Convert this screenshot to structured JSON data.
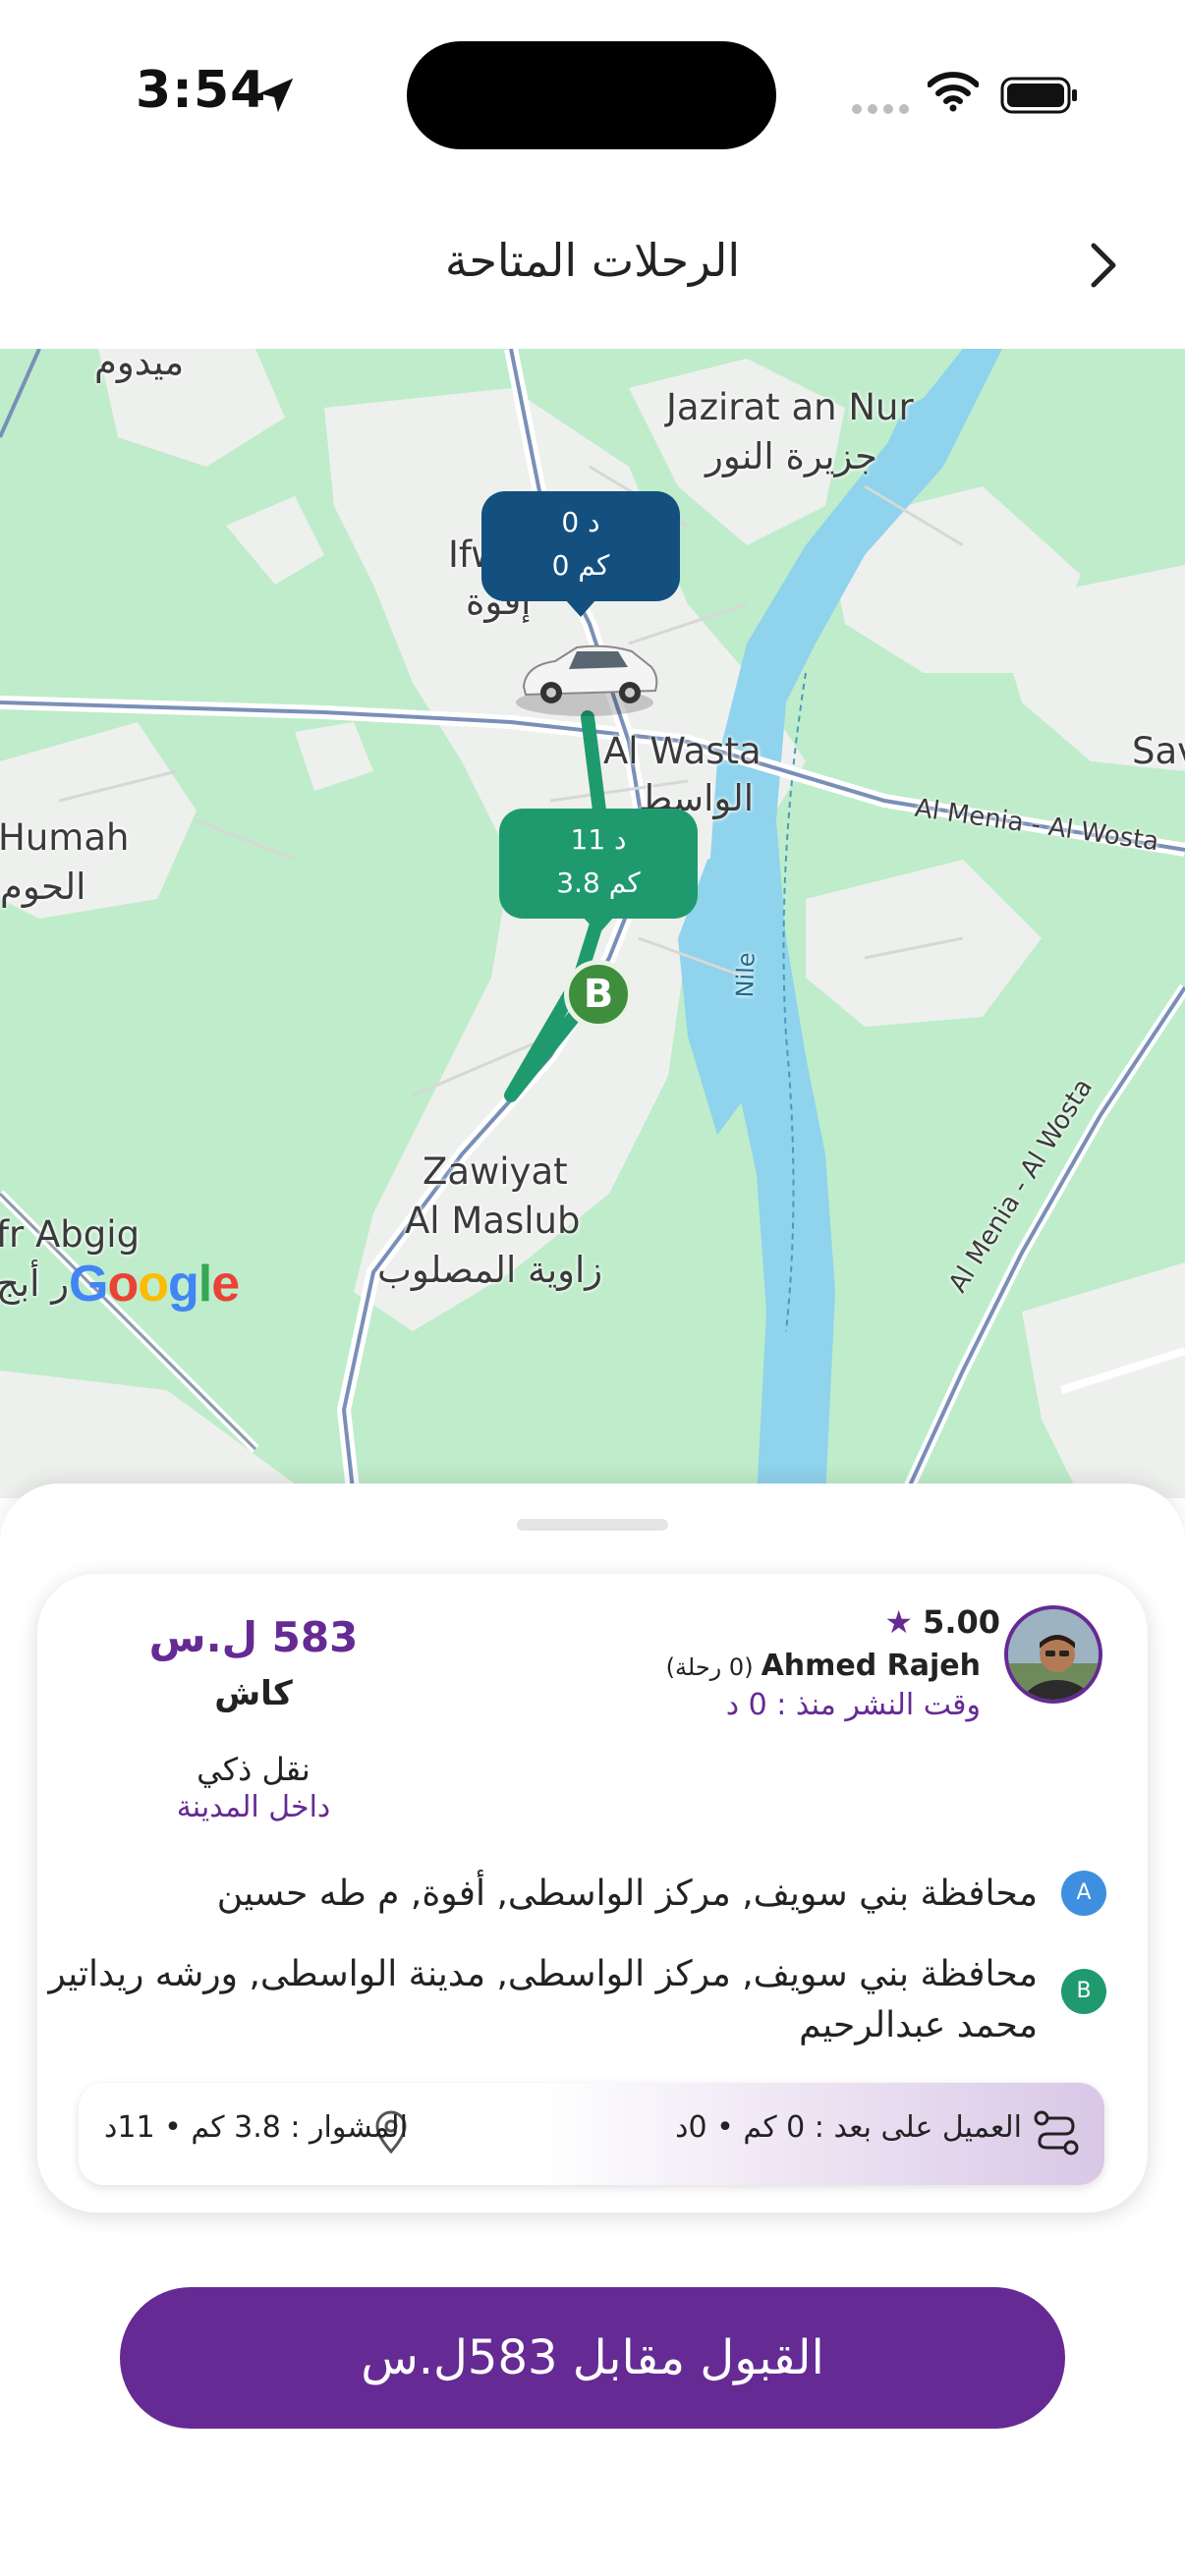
{
  "status_bar": {
    "time": "3:54",
    "icons": [
      "location-arrow-icon",
      "signal-icon",
      "wifi-icon",
      "battery-icon"
    ]
  },
  "header": {
    "title": "الرحلات المتاحة",
    "back_icon": "chevron-right-icon"
  },
  "map": {
    "labels": {
      "midoum": "ميدوم",
      "jazirat_en": "Jazirat an Nur",
      "jazirat_ar": "جزيرة النور",
      "ifwa_en": "Ifw",
      "ifwa_ar": "إفوة",
      "al_wasta_en": "Al Wasta",
      "al_wasta_ar": "الواسط",
      "sav": "Sav",
      "humah_en": "Humah",
      "humah_ar": "الحوم",
      "road_1": "Al Menia - Al Wosta",
      "road_2": "Al Menia - Al Wosta",
      "nile": "Nile",
      "zawiyat_1": "Zawiyat",
      "zawiyat_2": "Al Maslub",
      "zawiyat_ar": "زاوية المصلوب",
      "abgig_en": "fr Abgig",
      "abgig_ar": "ر أبج"
    },
    "google_logo": "Google",
    "driver_bubble": {
      "time": "0 د",
      "distance": "0 كم"
    },
    "trip_bubble": {
      "time": "11 د",
      "distance": "3.8 كم"
    },
    "destination_marker": "B",
    "colors": {
      "route": "#1f9a6f",
      "driver_bubble": "#13507f",
      "trip_bubble": "#1f9a6f",
      "water": "#8fd3ec"
    }
  },
  "trip": {
    "rating": "5.00",
    "driver_name": "Ahmed Rajeh",
    "trips_count": "(0 رحلة)",
    "posted_time": "وقت النشر منذ : 0 د",
    "price": "583 ل.س",
    "payment": "كاش",
    "ride_type": "نقل ذكي",
    "ride_scope": "داخل المدينة",
    "pickup_marker": "A",
    "pickup": "محافظة بني سويف, مركز الواسطى, أفوة, م طه حسين",
    "dropoff_marker": "B",
    "dropoff": "محافظة بني سويف, مركز الواسطى, مدينة الواسطى, ورشه ريداتير محمد عبدالرحيم",
    "client_distance": "العميل على بعد : 0 كم • 0د",
    "trip_distance": "المشوار : 3.8 كم • 11د"
  },
  "accept_button": "القبول مقابل 583ل.س",
  "theme": {
    "accent": "#652a93"
  }
}
